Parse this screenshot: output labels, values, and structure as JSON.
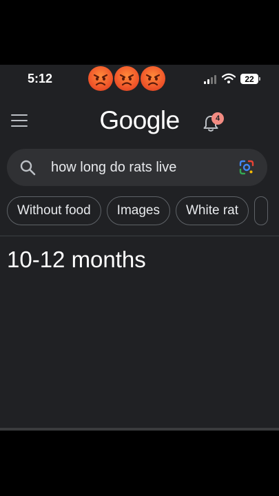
{
  "status_bar": {
    "time": "5:12",
    "battery": "22",
    "emojis": [
      "angry-face-icon",
      "angry-face-icon",
      "angry-face-icon"
    ]
  },
  "header": {
    "logo": "Google",
    "notification_count": "4"
  },
  "search": {
    "query": "how long do rats live"
  },
  "chips": [
    {
      "label": "Without food"
    },
    {
      "label": "Images"
    },
    {
      "label": "White rat"
    }
  ],
  "result": {
    "answer": "10-12 months"
  },
  "colors": {
    "background": "#202124",
    "search_bg": "#303134",
    "badge": "#f28b82",
    "text": "#e8eaed"
  }
}
